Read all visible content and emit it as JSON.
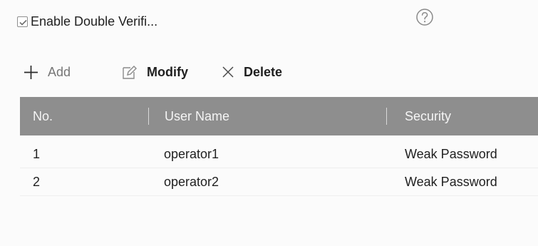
{
  "settings": {
    "double_verify_label": "Enable Double Verifi..."
  },
  "toolbar": {
    "add_label": "Add",
    "modify_label": "Modify",
    "delete_label": "Delete"
  },
  "users_table": {
    "headers": [
      "No.",
      "User Name",
      "Security"
    ],
    "rows": [
      {
        "no": "1",
        "user": "operator1",
        "security": "Weak Password"
      },
      {
        "no": "2",
        "user": "operator2",
        "security": "Weak Password"
      }
    ]
  },
  "icons": {
    "help": "help-icon",
    "add": "plus-icon",
    "modify": "edit-icon",
    "delete": "close-icon",
    "checkbox": "check-icon"
  },
  "colors": {
    "header_bg": "#8e8e8e",
    "page_bg": "#fbfbfb",
    "text": "#1f1f1f",
    "muted_text": "#767676"
  }
}
